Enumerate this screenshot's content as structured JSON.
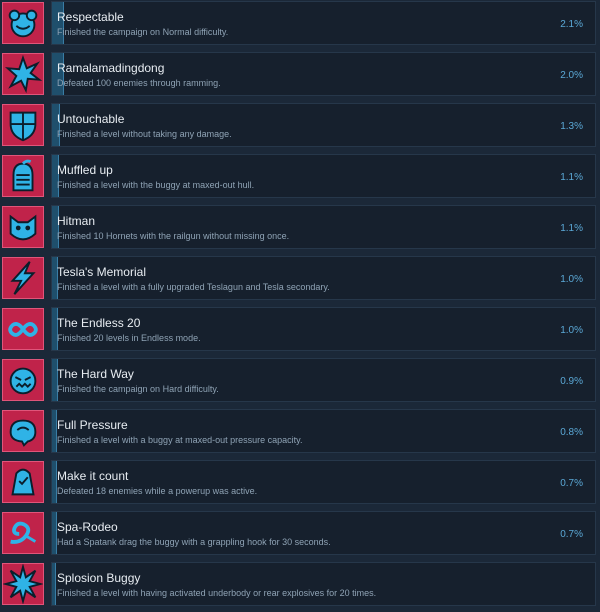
{
  "accent_color": "#5ba8d6",
  "icon_bg_color": "#c0234a",
  "achievements": [
    {
      "title": "Respectable",
      "description": "Finished the campaign on Normal difficulty.",
      "percent_label": "2.1%",
      "percent": 2.1,
      "icon": "bear-head-icon"
    },
    {
      "title": "Ramalamadingdong",
      "description": "Defeated 100 enemies through ramming.",
      "percent_label": "2.0%",
      "percent": 2.0,
      "icon": "explosion-icon"
    },
    {
      "title": "Untouchable",
      "description": "Finished a level without taking any damage.",
      "percent_label": "1.3%",
      "percent": 1.3,
      "icon": "shield-icon"
    },
    {
      "title": "Muffled up",
      "description": "Finished a level with the buggy at maxed-out hull.",
      "percent_label": "1.1%",
      "percent": 1.1,
      "icon": "knight-helmet-icon"
    },
    {
      "title": "Hitman",
      "description": "Finished 10 Hornets with the railgun without missing once.",
      "percent_label": "1.1%",
      "percent": 1.1,
      "icon": "hornet-icon"
    },
    {
      "title": "Tesla's Memorial",
      "description": "Finished a level with a fully upgraded Teslagun and Tesla secondary.",
      "percent_label": "1.0%",
      "percent": 1.0,
      "icon": "lightning-icon"
    },
    {
      "title": "The Endless 20",
      "description": "Finished 20 levels in Endless mode.",
      "percent_label": "1.0%",
      "percent": 1.0,
      "icon": "infinity-icon"
    },
    {
      "title": "The Hard Way",
      "description": "Finished the campaign on Hard difficulty.",
      "percent_label": "0.9%",
      "percent": 0.9,
      "icon": "angry-monster-icon"
    },
    {
      "title": "Full Pressure",
      "description": "Finished a level with a buggy at maxed-out pressure capacity.",
      "percent_label": "0.8%",
      "percent": 0.8,
      "icon": "pressure-tank-icon"
    },
    {
      "title": "Make it count",
      "description": "Defeated 18 enemies while a powerup was active.",
      "percent_label": "0.7%",
      "percent": 0.7,
      "icon": "powerup-icon"
    },
    {
      "title": "Spa-Rodeo",
      "description": "Had a Spatank drag the buggy with a grappling hook for 30 seconds.",
      "percent_label": "0.7%",
      "percent": 0.7,
      "icon": "grappling-hook-icon"
    },
    {
      "title": "Splosion Buggy",
      "description": "Finished a level with having activated underbody or rear explosives for 20 times.",
      "percent_label": "",
      "percent": 0.6,
      "icon": "burst-icon"
    }
  ]
}
